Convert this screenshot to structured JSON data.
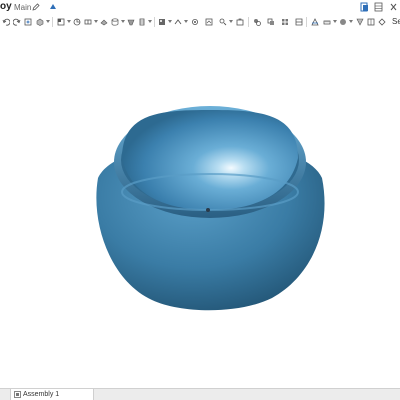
{
  "header": {
    "doc_title": "oy",
    "branch": "Main",
    "edit_icon": "pencil-icon",
    "version_icon": "version-graph-icon",
    "right_icons": [
      "document-icon",
      "grid-icon",
      "close-icon"
    ]
  },
  "toolbar": {
    "icons": [
      "undo-icon",
      "redo-icon",
      "insert-icon",
      "mate-icon",
      "fastened-mate-icon",
      "revolute-mate-icon",
      "slider-mate-icon",
      "planar-mate-icon",
      "cylindrical-mate-icon",
      "pin-slot-mate-icon",
      "ball-mate-icon",
      "parallel-mate-icon",
      "tangent-mate-icon",
      "gear-relation-icon",
      "rack-pinion-icon",
      "screw-relation-icon",
      "linear-relation-icon",
      "group-icon",
      "replicate-icon",
      "pattern-icon",
      "explode-icon",
      "section-view-icon",
      "measure-icon",
      "mass-properties-icon",
      "appearance-icon",
      "display-states-icon",
      "named-views-icon",
      "view-cube-icon"
    ],
    "search_label": "Se"
  },
  "tabs": [
    {
      "label": "Assembly 1",
      "icon": "assembly-icon"
    }
  ],
  "colors": {
    "model_blue": "#3a7ca5",
    "accent": "#1f5fa8"
  }
}
